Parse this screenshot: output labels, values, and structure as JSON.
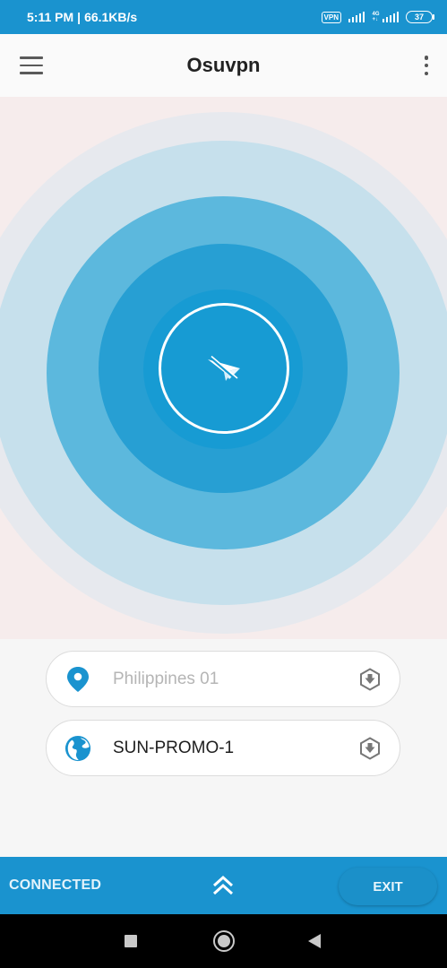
{
  "status_bar": {
    "time": "5:11 PM",
    "separator": "|",
    "speed": "66.1KB/s",
    "vpn_badge": "VPN",
    "network_type_top": "4G",
    "network_type_bottom": "+↓",
    "battery_level": "37",
    "icons": [
      "vpn-icon",
      "signal-icon",
      "signal-4g-icon",
      "battery-icon"
    ]
  },
  "header": {
    "title": "Osuvpn",
    "menu_icon": "hamburger-icon",
    "more_icon": "more-vert-icon"
  },
  "main": {
    "connect_icon": "paper-plane-icon",
    "colors": {
      "ring_outer": "#e7e9ee",
      "ring_2": "#c6e0ec",
      "ring_3": "#5cb8dd",
      "ring_4": "#279fd3",
      "ring_core": "#179bd3",
      "accent": "#1a93cf"
    }
  },
  "selectors": {
    "server": {
      "placeholder": "Philippines 01",
      "icon": "location-pin-icon",
      "action_icon": "download-icon"
    },
    "profile": {
      "value": "SUN-PROMO-1",
      "icon": "globe-icon",
      "action_icon": "download-icon"
    }
  },
  "bottom_bar": {
    "status": "CONNECTED",
    "expand_icon": "double-chevron-up-icon",
    "exit_label": "EXIT"
  },
  "nav_bar": {
    "buttons": [
      "recent-apps-icon",
      "home-icon",
      "back-icon"
    ]
  }
}
